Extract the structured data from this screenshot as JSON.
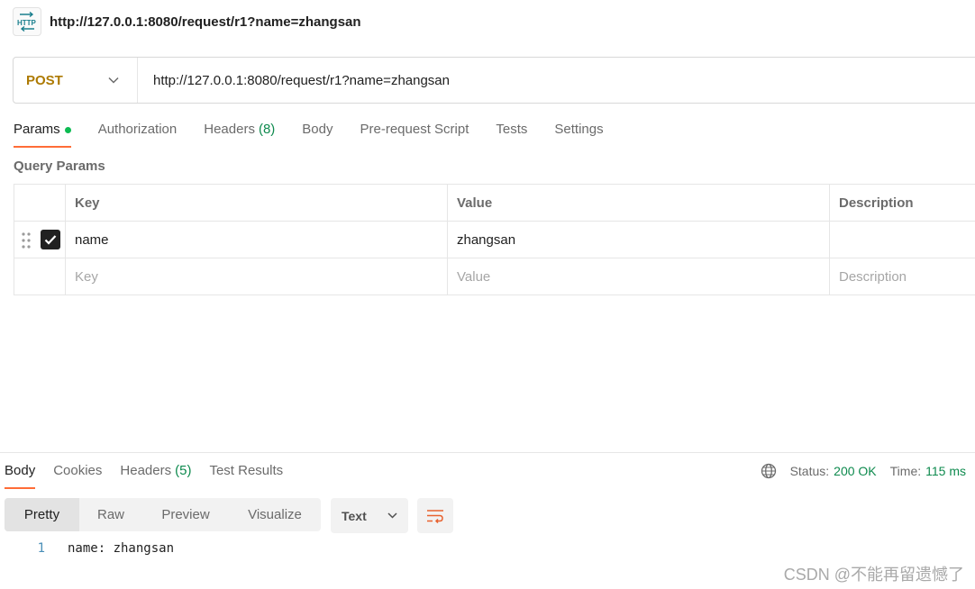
{
  "title": "http://127.0.0.1:8080/request/r1?name=zhangsan",
  "http_icon_label": "HTTP",
  "request": {
    "method": "POST",
    "url": "http://127.0.0.1:8080/request/r1?name=zhangsan"
  },
  "request_tabs": [
    {
      "label": "Params",
      "active": true,
      "indicator": "green-dot"
    },
    {
      "label": "Authorization"
    },
    {
      "label": "Headers",
      "count": "(8)"
    },
    {
      "label": "Body"
    },
    {
      "label": "Pre-request Script"
    },
    {
      "label": "Tests"
    },
    {
      "label": "Settings"
    }
  ],
  "query_params": {
    "title": "Query Params",
    "headers": {
      "key": "Key",
      "value": "Value",
      "description": "Description"
    },
    "rows": [
      {
        "checked": true,
        "key": "name",
        "value": "zhangsan",
        "description": ""
      }
    ],
    "placeholders": {
      "key": "Key",
      "value": "Value",
      "description": "Description"
    }
  },
  "response": {
    "tabs": [
      {
        "label": "Body",
        "active": true
      },
      {
        "label": "Cookies"
      },
      {
        "label": "Headers",
        "count": "(5)"
      },
      {
        "label": "Test Results"
      }
    ],
    "status_label": "Status:",
    "status_value": "200 OK",
    "time_label": "Time:",
    "time_value": "115 ms",
    "views": [
      "Pretty",
      "Raw",
      "Preview",
      "Visualize"
    ],
    "active_view": "Pretty",
    "format": "Text",
    "lines": [
      {
        "no": "1",
        "text": "name: zhangsan"
      }
    ]
  },
  "watermark": "CSDN @不能再留遗憾了",
  "colors": {
    "accent": "#ff6c37",
    "method_post": "#ad7a03",
    "success": "#0e8a4e",
    "params_dot": "#0cbb52"
  }
}
